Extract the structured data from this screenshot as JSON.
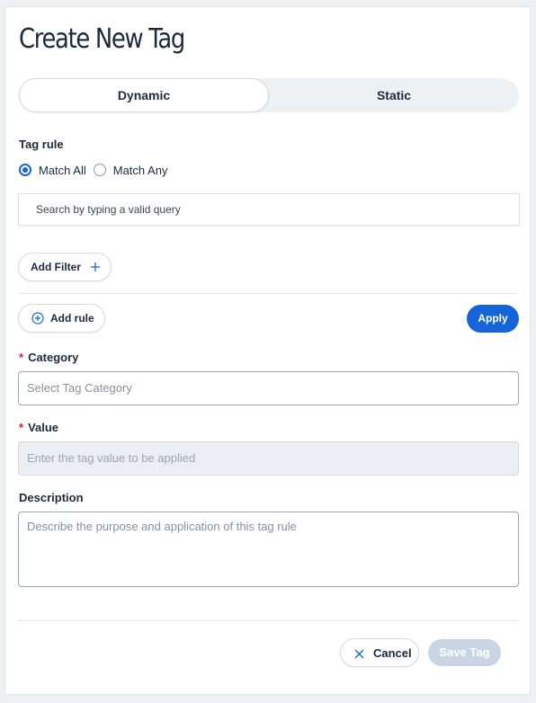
{
  "title": "Create New Tag",
  "tabs": [
    {
      "label": "Dynamic",
      "active": true
    },
    {
      "label": "Static",
      "active": false
    }
  ],
  "tag_rule": {
    "label": "Tag rule",
    "options": [
      {
        "label": "Match All",
        "checked": true
      },
      {
        "label": "Match Any",
        "checked": false
      }
    ],
    "search_placeholder": "Search by typing a valid query",
    "add_filter_label": "Add Filter",
    "add_rule_label": "Add rule",
    "apply_label": "Apply"
  },
  "form": {
    "category": {
      "label": "Category",
      "required": true,
      "placeholder": "Select Tag Category"
    },
    "value": {
      "label": "Value",
      "required": true,
      "placeholder": "Enter the tag value to be applied",
      "disabled": true
    },
    "description": {
      "label": "Description",
      "placeholder": "Describe the purpose and application of this tag rule"
    },
    "required_marker": "*"
  },
  "footer": {
    "cancel_label": "Cancel",
    "save_label": "Save Tag",
    "save_disabled": true
  },
  "colors": {
    "accent": "#1565d8",
    "required": "#c8262d",
    "text": "#1b2a3d"
  },
  "icons": {
    "add_filter": "plus-icon",
    "add_rule": "plus-circle-icon",
    "cancel": "close-icon"
  }
}
